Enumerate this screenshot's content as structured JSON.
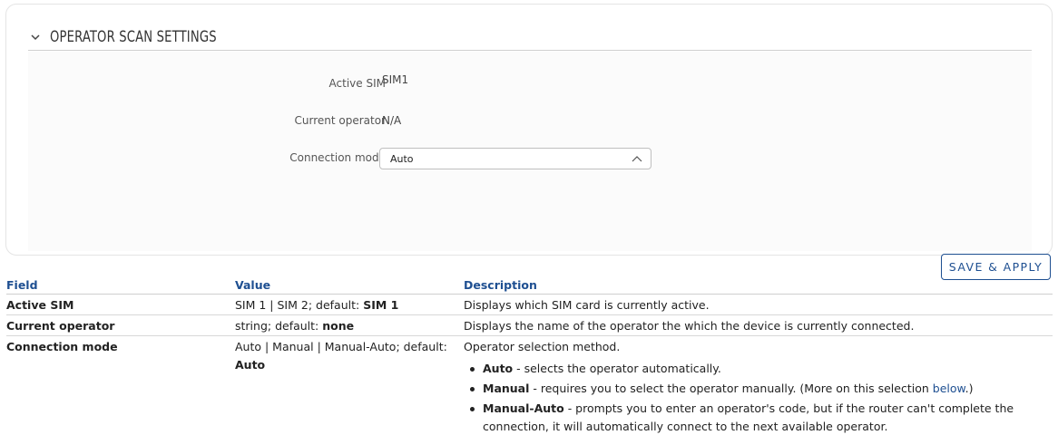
{
  "panel": {
    "title": "OPERATOR SCAN SETTINGS",
    "fields": {
      "active_sim_label": "Active SIM",
      "active_sim_value": "SIM1",
      "current_operator_label": "Current operator",
      "current_operator_value": "N/A",
      "connection_mode_label": "Connection mode",
      "connection_mode_value": "Auto"
    },
    "save_label": "SAVE & APPLY"
  },
  "doc_table": {
    "headers": {
      "field": "Field",
      "value": "Value",
      "description": "Description"
    },
    "rows": [
      {
        "field": "Active SIM",
        "value_prefix": "SIM 1 | SIM 2; default: ",
        "value_default": "SIM 1",
        "description": "Displays which SIM card is currently active."
      },
      {
        "field": "Current operator",
        "value_prefix": "string; default: ",
        "value_default": "none",
        "description": "Displays the name of the operator the which the device is currently connected."
      },
      {
        "field": "Connection mode",
        "value_prefix": "Auto | Manual | Manual-Auto; default: ",
        "value_default": "Auto",
        "description": "Operator selection method.",
        "bullets": [
          {
            "term": "Auto",
            "text": " - selects the operator automatically."
          },
          {
            "term": "Manual",
            "text": " - requires you to select the operator manually. (More on this selection ",
            "link": "below",
            "suffix": ".)"
          },
          {
            "term": "Manual-Auto",
            "text": " - prompts you to enter an operator's code, but if the router can't complete the connection, it will automatically connect to the next available operator."
          }
        ]
      }
    ]
  },
  "colors": {
    "accent": "#1e4f91",
    "border": "#e4e4e4",
    "text": "#222222"
  },
  "icons": {
    "collapse": "chevron-down-icon",
    "select_caret": "chevron-up-icon"
  }
}
